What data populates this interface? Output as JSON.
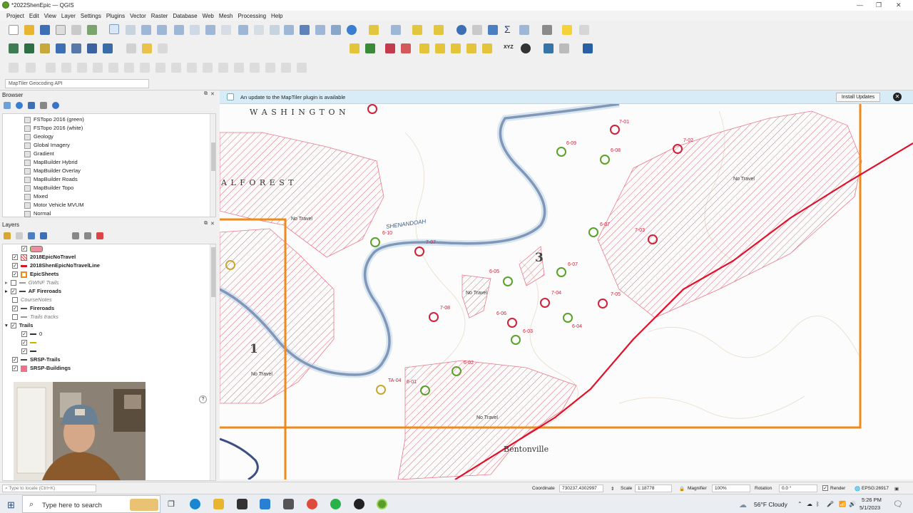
{
  "window": {
    "title": "*2022ShenEpic — QGIS"
  },
  "menu": [
    "Project",
    "Edit",
    "View",
    "Layer",
    "Settings",
    "Plugins",
    "Vector",
    "Raster",
    "Database",
    "Web",
    "Mesh",
    "Processing",
    "Help"
  ],
  "locator": {
    "geocode_placeholder": "MapTiler Geocoding API"
  },
  "browser": {
    "title": "Browser",
    "items": [
      "FSTopo 2016 (green)",
      "FSTopo 2016 (white)",
      "Geology",
      "Global Imagery",
      "Gradient",
      "MapBuilder Hybrid",
      "MapBuilder Overlay",
      "MapBuilder Roads",
      "MapBuilder Topo",
      "Mixed",
      "Motor Vehicle MVUM",
      "Normal"
    ]
  },
  "layers": {
    "title": "Layers",
    "items": [
      {
        "label": "2018EpicNoTravel",
        "checked": true,
        "bold": true,
        "symbol": "hatch"
      },
      {
        "label": "2018ShenEpicNoTravelLine",
        "checked": true,
        "bold": true,
        "symbol": "redline"
      },
      {
        "label": "EpicSheets",
        "checked": true,
        "bold": true,
        "symbol": "orange-box"
      },
      {
        "label": "GWNF Trails",
        "checked": false,
        "bold": false,
        "italic": true,
        "symbol": "line"
      },
      {
        "label": "AF Fireroads",
        "checked": true,
        "bold": true,
        "symbol": "line"
      },
      {
        "label": "CourseNotes",
        "checked": false,
        "bold": false,
        "italic": true,
        "symbol": "none"
      },
      {
        "label": "Fireroads",
        "checked": true,
        "bold": true,
        "symbol": "line"
      },
      {
        "label": "Trails tracks",
        "checked": false,
        "bold": false,
        "italic": true,
        "symbol": "line"
      },
      {
        "label": "Trails",
        "checked": true,
        "bold": true,
        "symbol": "none"
      },
      {
        "label": "0",
        "checked": true,
        "bold": false,
        "symbol": "dash"
      },
      {
        "label": "",
        "checked": true,
        "bold": false,
        "symbol": "yellow"
      },
      {
        "label": "",
        "checked": true,
        "bold": false,
        "symbol": "dash"
      },
      {
        "label": "SRSP-Trails",
        "checked": true,
        "bold": true,
        "symbol": "dash"
      },
      {
        "label": "SRSP-Buildings",
        "checked": true,
        "bold": true,
        "symbol": "pink"
      }
    ]
  },
  "notice": {
    "message": "An update to the MapTiler plugin is available",
    "button": "Install Updates"
  },
  "map": {
    "text_labels": [
      "W A S H I N G T O N",
      "A L   F O R E S T",
      "SHENANDOAH",
      "No Travel",
      "No Travel",
      "No Travel",
      "No Travel",
      "No Travel",
      "Bentonville",
      "1",
      "3"
    ],
    "red_controls": [
      "7-01",
      "7-02",
      "6-08",
      "7-03",
      "7-07",
      "7-08",
      "6-05",
      "7-04",
      "7-05",
      "6-06"
    ],
    "green_controls": [
      "6-09",
      "6-08",
      "6-07",
      "6-10",
      "6-04",
      "6-03",
      "6-02",
      "6-01",
      "TA-04"
    ]
  },
  "statusbar": {
    "locate_placeholder": "Type to locate (Ctrl+K)",
    "coordinate_label": "Coordinate",
    "coordinate": "730237,4302997",
    "scale_label": "Scale",
    "scale": "1:18778",
    "magnifier_label": "Magnifier",
    "magnifier": "100%",
    "rotation_label": "Rotation",
    "rotation": "0.0 °",
    "render_label": "Render",
    "crs": "EPSG:26917"
  },
  "taskbar": {
    "search_placeholder": "Type here to search",
    "weather": "56°F  Cloudy",
    "time": "5:26 PM",
    "date": "5/1/2023"
  },
  "colors": {
    "red_control": "#d0203a",
    "green_control": "#5aa12a",
    "sheet_border": "#f08a1a",
    "no_travel_line": "#e0102a"
  }
}
